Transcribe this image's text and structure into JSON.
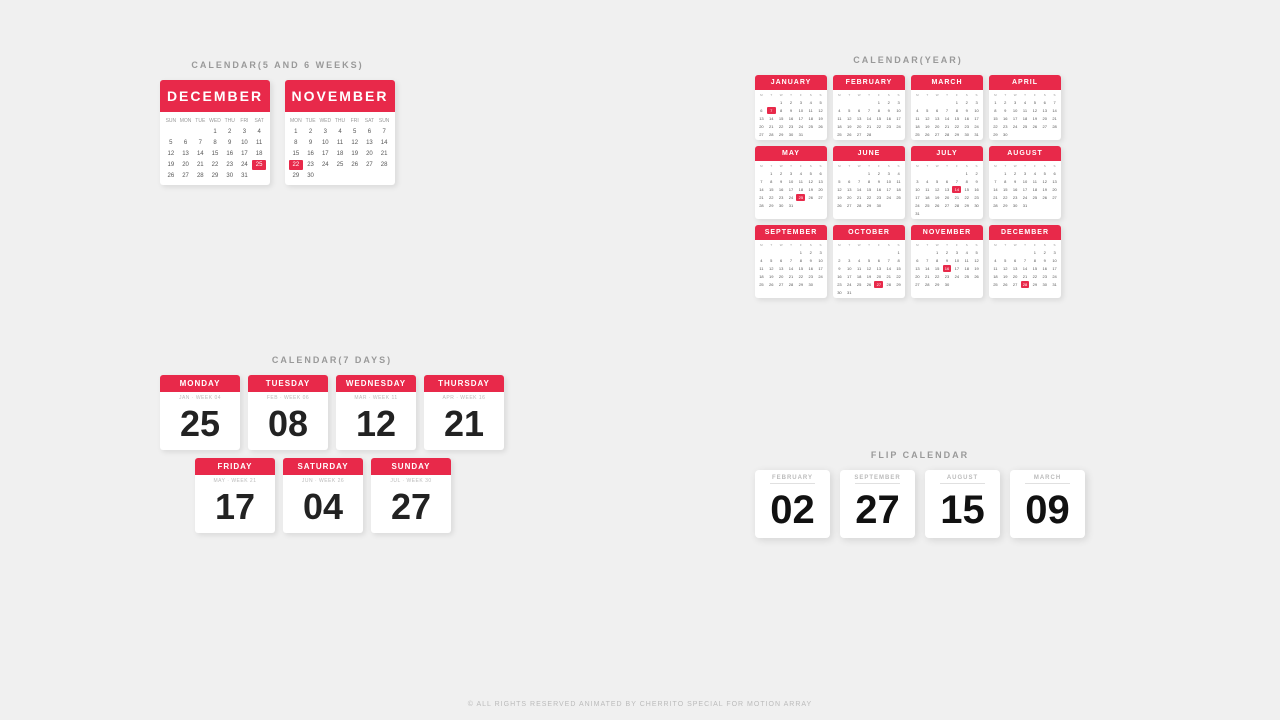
{
  "sections": {
    "five_six_label": "CALENDAR(5 AND 6 WEEKS)",
    "year_label": "CALENDAR(YEAR)",
    "seven_days_label": "CALENDAR(7 DAYS)",
    "flip_label": "FLIP CALENDAR",
    "footer": "© ALL RIGHTS RESERVED ANIMATED BY CHERRITO SPECIAL FOR MOTION ARRAY"
  },
  "large_calendars": [
    {
      "id": "december",
      "month": "DECEMBER",
      "days": [
        "SUN",
        "MON",
        "TUE",
        "WED",
        "THU",
        "FRI",
        "SAT"
      ],
      "dates": [
        "",
        "",
        "",
        "1",
        "2",
        "3",
        "4",
        "5",
        "6",
        "7",
        "8",
        "9",
        "10",
        "11",
        "12",
        "13",
        "14",
        "15",
        "16",
        "17",
        "18",
        "19",
        "20",
        "21",
        "22",
        "23",
        "24",
        "25",
        "26",
        "27",
        "28",
        "29",
        "30",
        "31",
        ""
      ],
      "today": "25"
    },
    {
      "id": "november",
      "month": "NOVEMBER",
      "days": [
        "MON",
        "TUE",
        "WED",
        "THU",
        "FRI",
        "SAT",
        "SUN"
      ],
      "dates": [
        "1",
        "2",
        "3",
        "4",
        "5",
        "6",
        "7",
        "8",
        "9",
        "10",
        "11",
        "12",
        "13",
        "14",
        "15",
        "16",
        "17",
        "18",
        "19",
        "20",
        "21",
        "22",
        "23",
        "24",
        "25",
        "26",
        "27",
        "28",
        "29",
        "30",
        "",
        "",
        "",
        "",
        ""
      ],
      "today": "22"
    }
  ],
  "year_months": [
    {
      "name": "JANUARY",
      "today": "7"
    },
    {
      "name": "FEBRUARY",
      "today": ""
    },
    {
      "name": "MARCH",
      "today": ""
    },
    {
      "name": "APRIL",
      "today": ""
    },
    {
      "name": "MAY",
      "today": ""
    },
    {
      "name": "JUNE",
      "today": ""
    },
    {
      "name": "JULY",
      "today": "14"
    },
    {
      "name": "AUGUST",
      "today": ""
    },
    {
      "name": "SEPTEMBER",
      "today": ""
    },
    {
      "name": "OCTOBER",
      "today": ""
    },
    {
      "name": "NOVEMBER",
      "today": "16"
    },
    {
      "name": "DECEMBER",
      "today": "28"
    }
  ],
  "day_cards": [
    {
      "day": "MONDAY",
      "meta": "JAN / WEEK 04",
      "number": "25"
    },
    {
      "day": "TUESDAY",
      "meta": "FEB / WEEK 06",
      "number": "08"
    },
    {
      "day": "WEDNESDAY",
      "meta": "MAR / WEEK 11",
      "number": "12"
    },
    {
      "day": "THURSDAY",
      "meta": "APR / WEEK 16",
      "number": "21"
    },
    {
      "day": "FRIDAY",
      "meta": "MAY / WEEK 21",
      "number": "17"
    },
    {
      "day": "SATURDAY",
      "meta": "JUN / WEEK 26",
      "number": "04"
    },
    {
      "day": "SUNDAY",
      "meta": "JUL / WEEK 30",
      "number": "27"
    }
  ],
  "flip_cards": [
    {
      "month": "FEBRUARY",
      "number": "02"
    },
    {
      "month": "SEPTEMBER",
      "number": "27"
    },
    {
      "month": "AUGUST",
      "number": "15"
    },
    {
      "month": "MARCH",
      "number": "09"
    }
  ],
  "colors": {
    "red": "#e8294a",
    "bg": "#f0f0f0"
  }
}
